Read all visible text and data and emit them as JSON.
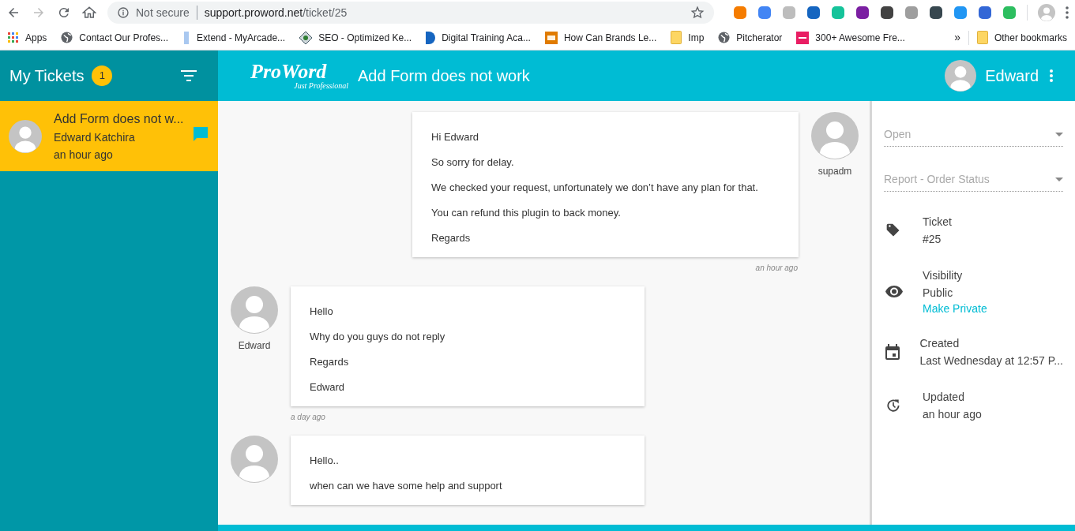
{
  "browser": {
    "security": "Not secure",
    "url_host": "support.proword.net",
    "url_path": "/ticket/25",
    "extensions": [
      {
        "color": "#f57c00"
      },
      {
        "color": "#4285f4"
      },
      {
        "color": "#bdbdbd"
      },
      {
        "color": "#1565c0"
      },
      {
        "color": "#15c39a"
      },
      {
        "color": "#7b1fa2"
      },
      {
        "color": "#424242"
      },
      {
        "color": "#9e9e9e"
      },
      {
        "color": "#37474f"
      },
      {
        "color": "#2196f3"
      },
      {
        "color": "#3367d6"
      },
      {
        "color": "#2dbe60"
      }
    ],
    "bookmarks": [
      {
        "label": "Apps",
        "kind": "apps"
      },
      {
        "label": "Contact Our Profes...",
        "kind": "globe"
      },
      {
        "label": "Extend - MyArcade...",
        "kind": "bar"
      },
      {
        "label": "SEO - Optimized Ke...",
        "kind": "diamond"
      },
      {
        "label": "Digital Training Aca...",
        "kind": "d"
      },
      {
        "label": "How Can Brands Le...",
        "kind": "hm"
      },
      {
        "label": "Imp",
        "kind": "folder"
      },
      {
        "label": "Pitcherator",
        "kind": "globe"
      },
      {
        "label": "300+ Awesome Fre...",
        "kind": "pink"
      }
    ],
    "overflow": "»",
    "other_bookmarks": "Other bookmarks"
  },
  "sidebar": {
    "title": "My Tickets",
    "count": "1",
    "tickets": [
      {
        "title": "Add Form does not w...",
        "author": "Edward Katchira",
        "time": "an hour ago",
        "selected": true
      }
    ]
  },
  "header": {
    "logo": "ProWord",
    "tagline": "Just Professional",
    "title": "Add Form does not work",
    "user": "Edward"
  },
  "messages": [
    {
      "kind": "outgoing",
      "author": "supadm",
      "time": "an hour ago",
      "lines": [
        "Hi Edward",
        "So sorry for delay.",
        "We checked your request, unfortunately we don’t have any plan for that.",
        "You can refund this plugin to back money.",
        "Regards"
      ]
    },
    {
      "kind": "incoming",
      "author": "Edward",
      "time": "a day ago",
      "lines": [
        "Hello",
        "Why do you guys do not reply",
        "Regards",
        "Edward"
      ]
    },
    {
      "kind": "incoming",
      "lines": [
        "Hello..",
        "when can we have some help and support"
      ]
    }
  ],
  "details": {
    "status": "Open",
    "category": "Report - Order Status",
    "info": [
      {
        "kind": "tag",
        "label": "Ticket",
        "value": "#25"
      },
      {
        "kind": "eye",
        "label": "Visibility",
        "value": "Public",
        "link": "Make Private"
      },
      {
        "kind": "calendar",
        "label": "Created",
        "value": "Last Wednesday at 12:57 P..."
      },
      {
        "kind": "history",
        "label": "Updated",
        "value": "an hour ago"
      }
    ]
  }
}
